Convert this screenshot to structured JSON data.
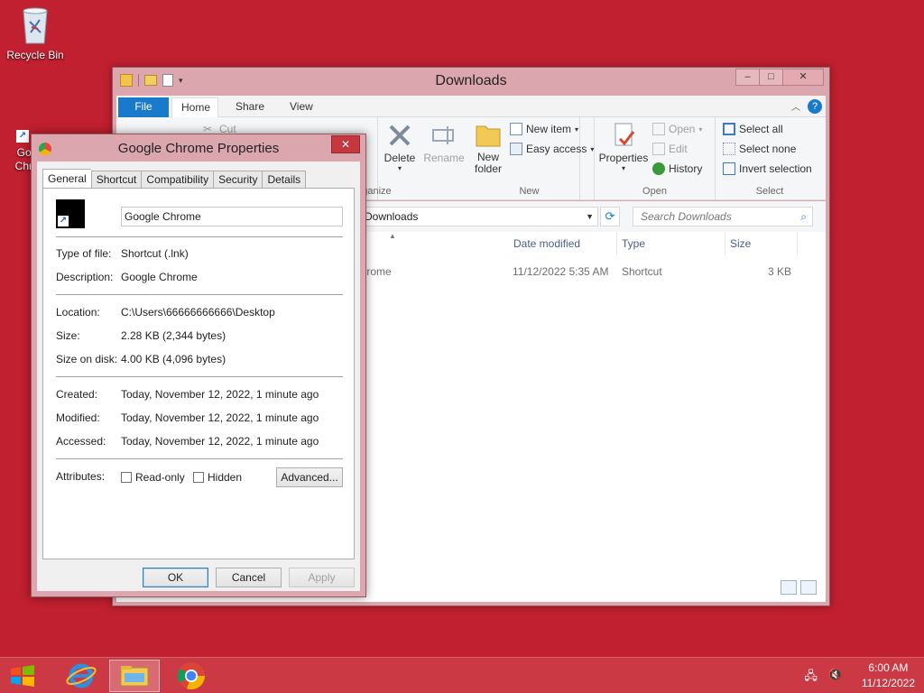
{
  "desktop": {
    "recycle_bin": "Recycle Bin",
    "chrome_icon_label": "Google Chrome"
  },
  "explorer": {
    "title": "Downloads",
    "tabs": [
      "File",
      "Home",
      "Share",
      "View"
    ],
    "ribbon": {
      "clipboard": {
        "cut": "Cut"
      },
      "organize": {
        "delete": "Delete",
        "rename": "Rename",
        "group": "Organize"
      },
      "new": {
        "new_folder": "New folder",
        "new_item": "New item",
        "easy_access": "Easy access",
        "group": "New"
      },
      "open": {
        "properties": "Properties",
        "open": "Open",
        "edit": "Edit",
        "history": "History",
        "group": "Open"
      },
      "select": {
        "select_all": "Select all",
        "select_none": "Select none",
        "invert": "Invert selection",
        "group": "Select"
      }
    },
    "address": "Downloads",
    "search_placeholder": "Search Downloads",
    "columns": {
      "date": "Date modified",
      "type": "Type",
      "size": "Size"
    },
    "rows": [
      {
        "name": "Google Chrome",
        "date": "11/12/2022 5:35 AM",
        "type": "Shortcut",
        "size": "3 KB"
      }
    ]
  },
  "properties": {
    "title": "Google Chrome Properties",
    "tabs": [
      "General",
      "Shortcut",
      "Compatibility",
      "Security",
      "Details"
    ],
    "name": "Google Chrome",
    "fields": {
      "type_label": "Type of file:",
      "type_value": "Shortcut (.lnk)",
      "desc_label": "Description:",
      "desc_value": "Google Chrome",
      "loc_label": "Location:",
      "loc_value": "C:\\Users\\66666666666\\Desktop",
      "size_label": "Size:",
      "size_value": "2.28 KB (2,344 bytes)",
      "disk_label": "Size on disk:",
      "disk_value": "4.00 KB (4,096 bytes)",
      "created_label": "Created:",
      "created_value": "Today, November 12, 2022, 1 minute ago",
      "modified_label": "Modified:",
      "modified_value": "Today, November 12, 2022, 1 minute ago",
      "accessed_label": "Accessed:",
      "accessed_value": "Today, November 12, 2022, 1 minute ago",
      "attr_label": "Attributes:"
    },
    "readonly": "Read-only",
    "hidden": "Hidden",
    "advanced": "Advanced...",
    "ok": "OK",
    "cancel": "Cancel",
    "apply": "Apply"
  },
  "taskbar": {
    "time": "6:00 AM",
    "date": "11/12/2022"
  }
}
